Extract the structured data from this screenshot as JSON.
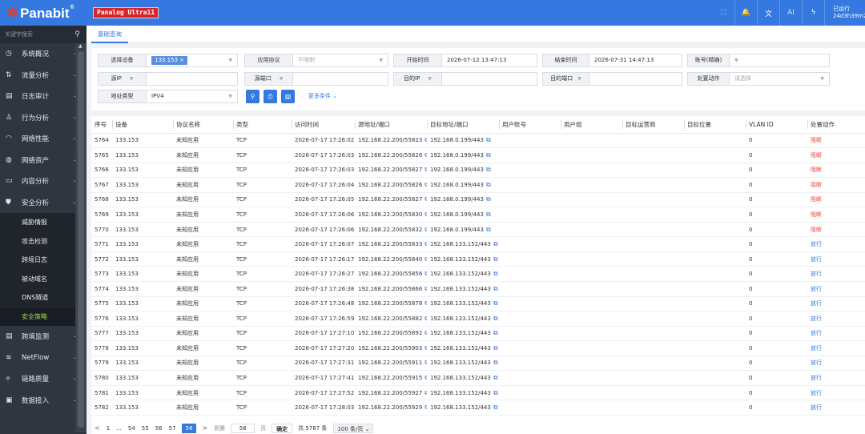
{
  "brand": {
    "name": "Panabit",
    "reg": "®",
    "product": "Panalog Ultra11"
  },
  "topbar": {
    "tools": [
      {
        "name": "fullscreen-icon",
        "glyph": "⛶"
      },
      {
        "name": "alarm-icon",
        "glyph": "🔔"
      },
      {
        "name": "translate-icon",
        "glyph": "文"
      },
      {
        "name": "ai-icon",
        "glyph": "AI"
      },
      {
        "name": "lightning-icon",
        "glyph": "ϟ"
      }
    ],
    "uptime_label": "已运行",
    "uptime_value": "24d3h39m29"
  },
  "sidebar": {
    "search_placeholder": "关键字搜索",
    "items": [
      {
        "label": "系统概况",
        "icon": "dashboard-icon",
        "glyph": "◷"
      },
      {
        "label": "流量分析",
        "icon": "traffic-icon",
        "glyph": "⇅"
      },
      {
        "label": "日志审计",
        "icon": "log-icon",
        "glyph": "▤"
      },
      {
        "label": "行为分析",
        "icon": "user-icon",
        "glyph": "♙"
      },
      {
        "label": "网络性能",
        "icon": "wifi-icon",
        "glyph": "◠"
      },
      {
        "label": "网络资产",
        "icon": "globe-icon",
        "glyph": "◍"
      },
      {
        "label": "内容分析",
        "icon": "content-icon",
        "glyph": "▭"
      },
      {
        "label": "安全分析",
        "icon": "shield-icon",
        "glyph": "⛊"
      }
    ],
    "sub_items": [
      "威胁情报",
      "攻击检测",
      "跨境日志",
      "被动域名",
      "DNS隧道",
      "安全策略"
    ],
    "bottom_items": [
      {
        "label": "跨境监测",
        "icon": "monitor-icon",
        "glyph": "▤"
      },
      {
        "label": "NetFlow",
        "icon": "netflow-icon",
        "glyph": "≋"
      },
      {
        "label": "链路质量",
        "icon": "link-icon",
        "glyph": "⟡"
      },
      {
        "label": "数据接入",
        "icon": "database-icon",
        "glyph": "▣"
      }
    ]
  },
  "tab": {
    "label": "基础查询"
  },
  "filters": {
    "device_label": "选择设备",
    "device_tag": "133.153 ×",
    "protocol_label": "应用协议",
    "protocol_value": "不限制",
    "start_label": "开始时间",
    "start_value": "2026-07-12 13:47:13",
    "end_label": "结束时间",
    "end_value": "2026-07-31 14:47:13",
    "account_label": "账号(精确)",
    "src_ip_label": "源IP",
    "src_port_label": "源端口",
    "dst_ip_label": "目的IP",
    "dst_port_label": "目的端口",
    "action_label": "处置动作",
    "action_placeholder": "请选择",
    "addr_type_label": "地址类型",
    "addr_type_value": "IPV4",
    "more_label": "更多条件"
  },
  "table": {
    "headers": [
      "序号",
      "设备",
      "协议名称",
      "类型",
      "访问时间",
      "源地址/端口",
      "目标地址/端口",
      "用户账号",
      "用户组",
      "目标运营商",
      "目标位置",
      "VLAN ID",
      "处置动作"
    ],
    "rows": [
      [
        "5764",
        "133.153",
        "未知应用",
        "TCP",
        "2026-07-17 17:26:02",
        "192.168.22.200/55823",
        "192.168.0.199/443",
        "",
        "",
        "",
        "",
        "0",
        "阻断"
      ],
      [
        "5765",
        "133.153",
        "未知应用",
        "TCP",
        "2026-07-17 17:26:03",
        "192.168.22.200/55826",
        "192.168.0.199/443",
        "",
        "",
        "",
        "",
        "0",
        "阻断"
      ],
      [
        "5766",
        "133.153",
        "未知应用",
        "TCP",
        "2026-07-17 17:26:03",
        "192.168.22.200/55827",
        "192.168.0.199/443",
        "",
        "",
        "",
        "",
        "0",
        "阻断"
      ],
      [
        "5767",
        "133.153",
        "未知应用",
        "TCP",
        "2026-07-17 17:26:04",
        "192.168.22.200/55826",
        "192.168.0.199/443",
        "",
        "",
        "",
        "",
        "0",
        "阻断"
      ],
      [
        "5768",
        "133.153",
        "未知应用",
        "TCP",
        "2026-07-17 17:26:05",
        "192.168.22.200/55827",
        "192.168.0.199/443",
        "",
        "",
        "",
        "",
        "0",
        "阻断"
      ],
      [
        "5769",
        "133.153",
        "未知应用",
        "TCP",
        "2026-07-17 17:26:06",
        "192.168.22.200/55830",
        "192.168.0.199/443",
        "",
        "",
        "",
        "",
        "0",
        "阻断"
      ],
      [
        "5770",
        "133.153",
        "未知应用",
        "TCP",
        "2026-07-17 17:26:06",
        "192.168.22.200/55832",
        "192.168.0.199/443",
        "",
        "",
        "",
        "",
        "0",
        "阻断"
      ],
      [
        "5771",
        "133.153",
        "未知应用",
        "TCP",
        "2026-07-17 17:26:07",
        "192.168.22.200/55833",
        "192.168.133.152/443",
        "",
        "",
        "",
        "",
        "0",
        "放行"
      ],
      [
        "5772",
        "133.153",
        "未知应用",
        "TCP",
        "2026-07-17 17:26:17",
        "192.168.22.200/55840",
        "192.168.133.152/443",
        "",
        "",
        "",
        "",
        "0",
        "放行"
      ],
      [
        "5773",
        "133.153",
        "未知应用",
        "TCP",
        "2026-07-17 17:26:27",
        "192.168.22.200/55856",
        "192.168.133.152/443",
        "",
        "",
        "",
        "",
        "0",
        "放行"
      ],
      [
        "5774",
        "133.153",
        "未知应用",
        "TCP",
        "2026-07-17 17:26:38",
        "192.168.22.200/55866",
        "192.168.133.152/443",
        "",
        "",
        "",
        "",
        "0",
        "放行"
      ],
      [
        "5775",
        "133.153",
        "未知应用",
        "TCP",
        "2026-07-17 17:26:48",
        "192.168.22.200/55878",
        "192.168.133.152/443",
        "",
        "",
        "",
        "",
        "0",
        "放行"
      ],
      [
        "5776",
        "133.153",
        "未知应用",
        "TCP",
        "2026-07-17 17:26:59",
        "192.168.22.200/55882",
        "192.168.133.152/443",
        "",
        "",
        "",
        "",
        "0",
        "放行"
      ],
      [
        "5777",
        "133.153",
        "未知应用",
        "TCP",
        "2026-07-17 17:27:10",
        "192.168.22.200/55892",
        "192.168.133.152/443",
        "",
        "",
        "",
        "",
        "0",
        "放行"
      ],
      [
        "5778",
        "133.153",
        "未知应用",
        "TCP",
        "2026-07-17 17:27:20",
        "192.168.22.200/55903",
        "192.168.133.152/443",
        "",
        "",
        "",
        "",
        "0",
        "放行"
      ],
      [
        "5779",
        "133.153",
        "未知应用",
        "TCP",
        "2026-07-17 17:27:31",
        "192.168.22.200/55911",
        "192.168.133.152/443",
        "",
        "",
        "",
        "",
        "0",
        "放行"
      ],
      [
        "5780",
        "133.153",
        "未知应用",
        "TCP",
        "2026-07-17 17:27:41",
        "192.168.22.200/55915",
        "192.168.133.152/443",
        "",
        "",
        "",
        "",
        "0",
        "放行"
      ],
      [
        "5781",
        "133.153",
        "未知应用",
        "TCP",
        "2026-07-17 17:27:52",
        "192.168.22.200/55927",
        "192.168.133.152/443",
        "",
        "",
        "",
        "",
        "0",
        "放行"
      ],
      [
        "5782",
        "133.153",
        "未知应用",
        "TCP",
        "2026-07-17 17:28:03",
        "192.168.22.200/55929",
        "192.168.133.152/443",
        "",
        "",
        "",
        "",
        "0",
        "放行"
      ]
    ],
    "copy_icon": "⧉"
  },
  "pager": {
    "prev": "<",
    "pages": [
      "1",
      "...",
      "54",
      "55",
      "56",
      "57"
    ],
    "current": "58",
    "next": ">",
    "goto_label": "到第",
    "goto_value": "58",
    "page_unit": "页",
    "confirm": "确定",
    "total": "共 5787 条",
    "per_page": "100 条/页 ⌄"
  },
  "colors": {
    "accent": "#3478e0",
    "block": "#f04141",
    "sidebar": "#2f3640",
    "active_sub": "#9fd15a"
  }
}
